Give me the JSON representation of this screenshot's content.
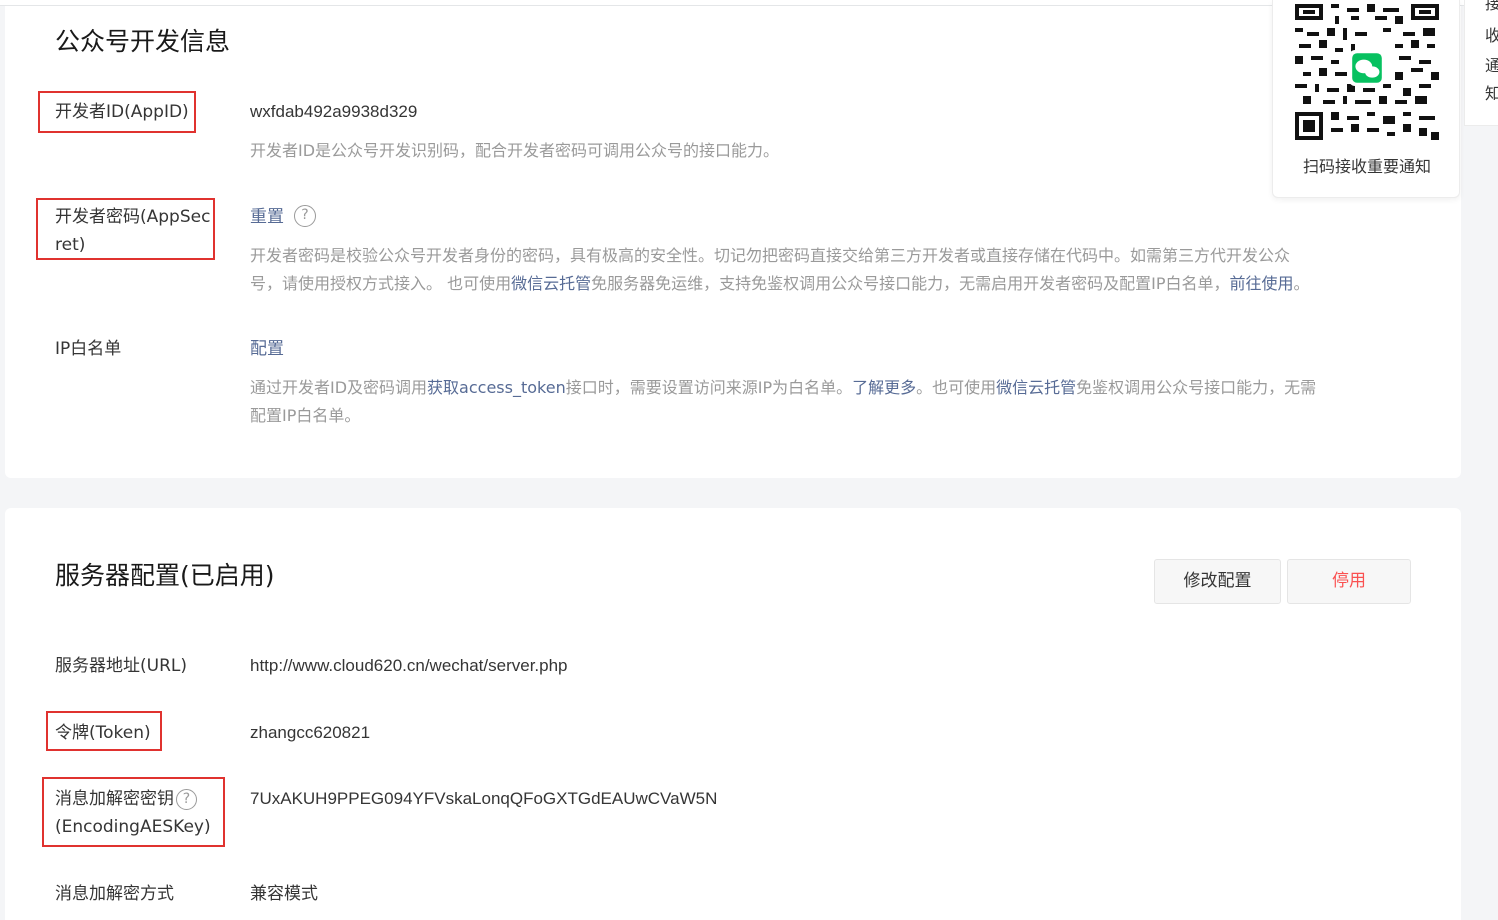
{
  "dev_section": {
    "title": "公众号开发信息",
    "appid_label": "开发者ID(AppID)",
    "appid_value": "wxfdab492a9938d329",
    "appid_desc": "开发者ID是公众号开发识别码，配合开发者密码可调用公众号的接口能力。",
    "secret_label_line1": "开发者密码(AppSec",
    "secret_label_line2": "ret)",
    "secret_action": "重置",
    "secret_desc_line1": "开发者密码是校验公众号开发者身份的密码，具有极高的安全性。切记勿把密码直接交给第三方开发者或直接存储在代码中。如需第三方代开发公众",
    "secret_desc_line2_a": "号，请使用授权方式接入。 也可使用",
    "secret_desc_link1": "微信云托管",
    "secret_desc_line2_b": "免服务器免运维，支持免鉴权调用公众号接口能力，无需启用开发者密码及配置IP白名单，",
    "secret_desc_link2": "前往使用",
    "secret_desc_end": "。",
    "ip_label": "IP白名单",
    "ip_action": "配置",
    "ip_desc_a": "通过开发者ID及密码调用",
    "ip_desc_link1": "获取access_token",
    "ip_desc_b": "接口时，需要设置访问来源IP为白名单。",
    "ip_desc_link2": "了解更多",
    "ip_desc_c": "。也可使用",
    "ip_desc_link3": "微信云托管",
    "ip_desc_d": "免鉴权调用公众号接口能力，无需",
    "ip_desc_line2": "配置IP白名单。"
  },
  "qr_panel": {
    "caption": "扫码接收重要通知",
    "icon": "wechat-logo-icon"
  },
  "side_panel": {
    "chars": [
      "接",
      "收",
      "通",
      "知"
    ]
  },
  "server_section": {
    "title": "服务器配置(已启用)",
    "edit_button": "修改配置",
    "stop_button": "停用",
    "url_label": "服务器地址(URL)",
    "url_value": "http://www.cloud620.cn/wechat/server.php",
    "token_label": "令牌(Token)",
    "token_value": "zhangcc620821",
    "aes_label_line1": "消息加解密密钥",
    "aes_label_line2": "(EncodingAESKey)",
    "aes_value": "7UxAKUH9PPEG094YFVskaLonqQFoGXTGdEAUwCVaW5N",
    "mode_label": "消息加解密方式",
    "mode_value": "兼容模式"
  },
  "colors": {
    "link": "#576b95",
    "danger": "#fa5151",
    "highlight_box": "#e0322f",
    "wechat_green": "#07c160"
  }
}
